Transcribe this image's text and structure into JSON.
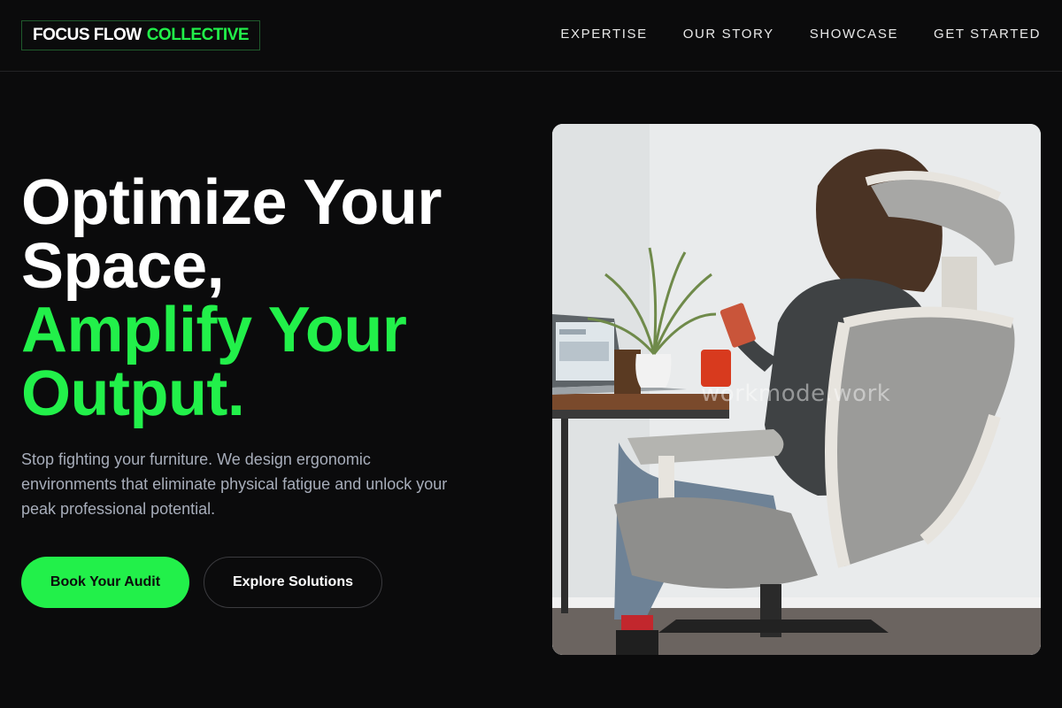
{
  "brand": {
    "name_part1": "FOCUS FLOW",
    "name_part2": "COLLECTIVE"
  },
  "nav": {
    "items": [
      "EXPERTISE",
      "OUR STORY",
      "SHOWCASE",
      "GET STARTED"
    ]
  },
  "hero": {
    "headline_lines": [
      "Optimize Your",
      "Space,"
    ],
    "headline_accent_lines": [
      "Amplify Your",
      "Output."
    ],
    "description": "Stop fighting your furniture. We design ergonomic environments that eliminate physical fatigue and unlock your peak professional potential.",
    "primary_button": "Book Your Audit",
    "secondary_button": "Explore Solutions",
    "image": {
      "alt": "Person sitting in an ergonomic mesh office chair at a desk with a laptop and plant",
      "watermark": "workmode.work"
    }
  },
  "colors": {
    "accent": "#22f04a",
    "background": "#0b0b0c",
    "muted_text": "#a7adba"
  }
}
